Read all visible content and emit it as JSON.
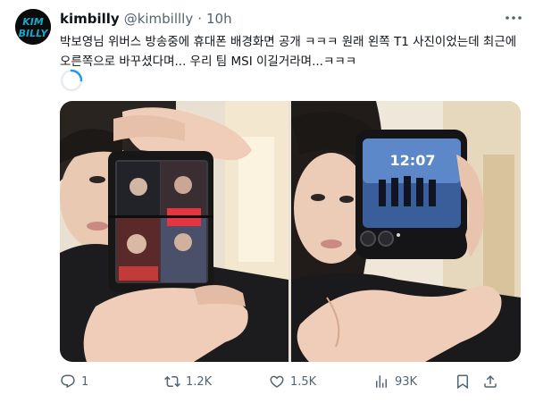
{
  "tweet": {
    "avatar_text": "KIM BILLY",
    "display_name": "kimbilly",
    "handle": "@kimbillly",
    "separator": "·",
    "time": "10h",
    "text": "박보영님 위버스 방송중에 휴대폰 배경화면 공개 ㅋㅋㅋ 원래 왼쪽 T1 사진이었는데 최근에 오른쪽으로 바꾸셨다며... 우리 팀 MSI 이길거라며...ㅋㅋㅋ",
    "right_phone_clock": "12:07",
    "actions": {
      "reply_count": "1",
      "retweet_count": "1.2K",
      "like_count": "1.5K",
      "view_count": "93K"
    }
  },
  "icons": {
    "more": "more-horizontal-icon",
    "reply": "reply-icon",
    "retweet": "retweet-icon",
    "like": "heart-icon",
    "views": "views-icon",
    "bookmark": "bookmark-icon",
    "share": "share-icon"
  },
  "colors": {
    "text_primary": "#0f1419",
    "text_secondary": "#536471",
    "avatar_accent": "#19a8c8"
  }
}
